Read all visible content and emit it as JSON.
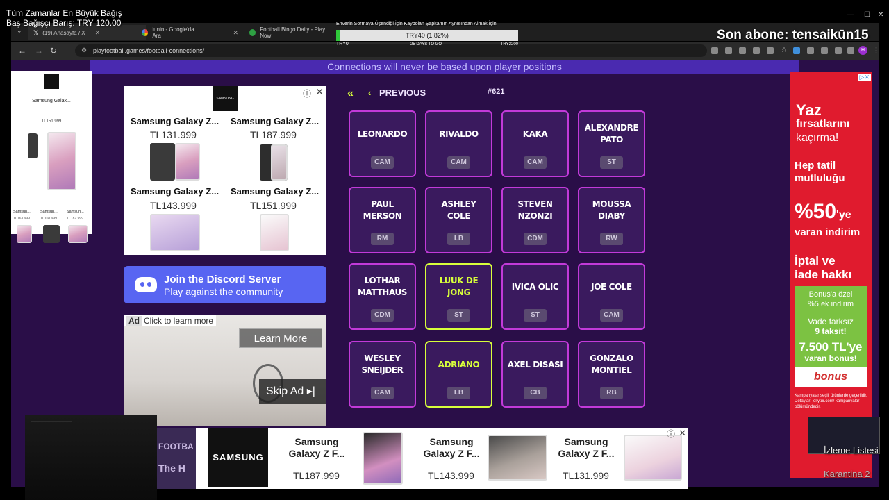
{
  "overlay": {
    "donation_title": "Tüm Zamanlar En Büyük Bağış",
    "donation_value": "Baş Bağışçı Barış: TRY 120.00",
    "latest_sub": "Son abone: tensaikūn15",
    "goal_title": "Enverin Sormaya Üşendiği İçin Kaybolan Şapkamın Aynısından Almak İçin",
    "goal_amount": "TRY40 (1.82%)",
    "goal_progress": 0.0182,
    "goal_min": "TRY0",
    "goal_days": "25 DAYS TO GO",
    "goal_max": "TRY2200",
    "watchlist": "İzleme Listesi",
    "quarantine": "Karantina 2"
  },
  "browser": {
    "tabs": [
      {
        "label": "(19) Anasayfa / X",
        "icon": "x-logo-icon"
      },
      {
        "label": "lunin - Google'da Ara",
        "icon": "google-icon"
      },
      {
        "label": "Football Bingo Daily - Play Now",
        "icon": "football-icon"
      }
    ],
    "url": "playfootball.games/football-connections/"
  },
  "page": {
    "banner": "Connections will never be based upon player positions",
    "previous_label": "PREVIOUS",
    "puzzle_number": "#621",
    "tiles": [
      {
        "name": "LEONARDO",
        "pos": "CAM",
        "selected": false
      },
      {
        "name": "RIVALDO",
        "pos": "CAM",
        "selected": false
      },
      {
        "name": "KAKA",
        "pos": "CAM",
        "selected": false
      },
      {
        "name": "ALEXANDRE PATO",
        "pos": "ST",
        "selected": false
      },
      {
        "name": "PAUL MERSON",
        "pos": "RM",
        "selected": false
      },
      {
        "name": "ASHLEY COLE",
        "pos": "LB",
        "selected": false
      },
      {
        "name": "STEVEN NZONZI",
        "pos": "CDM",
        "selected": false
      },
      {
        "name": "MOUSSA DIABY",
        "pos": "RW",
        "selected": false
      },
      {
        "name": "LOTHAR MATTHAUS",
        "pos": "CDM",
        "selected": false
      },
      {
        "name": "LUUK DE JONG",
        "pos": "ST",
        "selected": true
      },
      {
        "name": "IVICA OLIC",
        "pos": "ST",
        "selected": false
      },
      {
        "name": "JOE COLE",
        "pos": "CAM",
        "selected": false
      },
      {
        "name": "WESLEY SNEIJDER",
        "pos": "CAM",
        "selected": false
      },
      {
        "name": "ADRIANO",
        "pos": "LB",
        "selected": true
      },
      {
        "name": "AXEL DISASI",
        "pos": "CB",
        "selected": false
      },
      {
        "name": "GONZALO MONTIEL",
        "pos": "RB",
        "selected": false
      }
    ],
    "discord_title": "Join the Discord Server",
    "discord_sub": "Play against the community"
  },
  "ads": {
    "left": {
      "brand": "SAMSUNG",
      "title": "Samsung Galax...",
      "price": "TL151.999",
      "mini": [
        {
          "n": "Samsun...",
          "p": "TL163.999"
        },
        {
          "n": "Samsun...",
          "p": "TL108.999"
        },
        {
          "n": "Samsun...",
          "p": "TL187.999"
        }
      ]
    },
    "main": {
      "brand": "SAMSUNG",
      "products": [
        {
          "name": "Samsung Galaxy Z...",
          "price": "TL131.999"
        },
        {
          "name": "Samsung Galaxy Z...",
          "price": "TL187.999"
        },
        {
          "name": "Samsung Galaxy Z...",
          "price": "TL143.999"
        },
        {
          "name": "Samsung Galaxy Z...",
          "price": "TL151.999"
        }
      ]
    },
    "video": {
      "tag": "Ad",
      "click": "Click to learn more",
      "learn_more": "Learn More",
      "skip": "Skip Ad"
    },
    "right": {
      "l1": "Yaz",
      "l2": "fırsatlarını",
      "l3": "kaçırma!",
      "l4": "Hep tatil",
      "l5": "mutluluğu",
      "pct": "%50",
      "pct_suffix": "'ye",
      "l6": "varan indirim",
      "l7": "İptal ve",
      "l8": "iade hakkı",
      "g1": "Bonus'a özel",
      "g2": "%5 ek indirim",
      "g3": "Vade farksız",
      "g4": "9 taksit!",
      "g5": "7.500 TL'ye",
      "g6": "varan bonus!",
      "bonus": "bonus",
      "fine": "Kampanyalar seçili ürünlerde geçerlidir. Detaylar: jollytur.com/ kampanyalar bölümündedir."
    },
    "bottom": {
      "brand": "SAMSUNG",
      "side": "FOOTBA",
      "side2": "The H",
      "products": [
        {
          "name": "Samsung Galaxy Z F...",
          "price": "TL187.999"
        },
        {
          "name": "Samsung Galaxy Z F...",
          "price": "TL143.999"
        },
        {
          "name": "Samsung Galaxy Z F...",
          "price": "TL131.999"
        }
      ]
    }
  },
  "colors": {
    "page_bg": "#2a0e48",
    "tile_border": "#c23ad9",
    "tile_selected": "#d8ff3b",
    "banner": "#4a2ab0",
    "discord": "#5865f2",
    "ad_red": "#e01b2e"
  }
}
